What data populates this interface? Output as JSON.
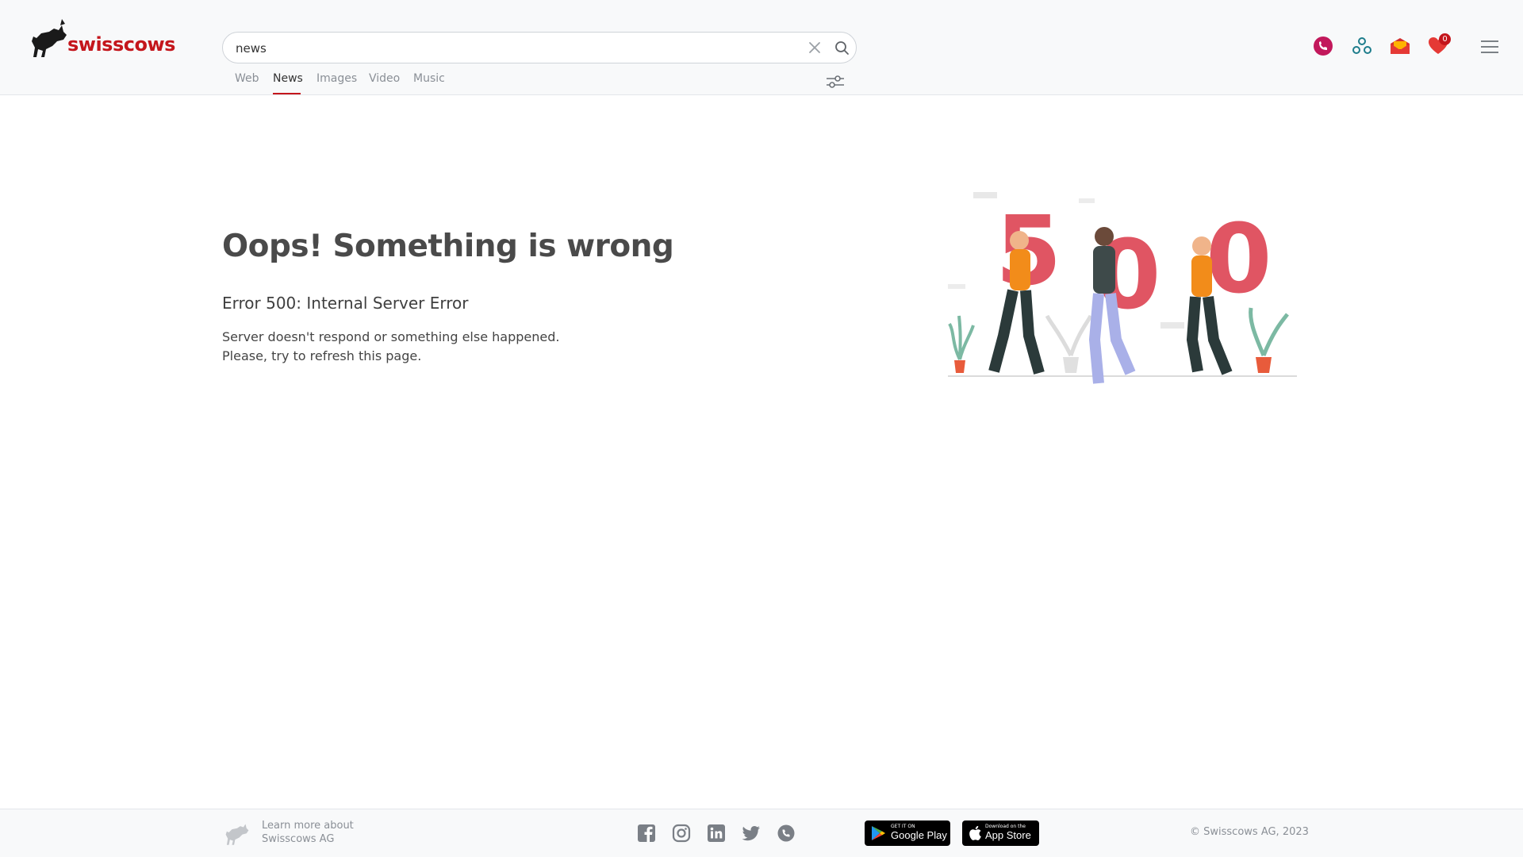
{
  "brand": {
    "name": "swisscows",
    "accent": "#c4161c"
  },
  "search": {
    "value": "news",
    "clear_icon": "close-icon",
    "search_icon": "search-icon"
  },
  "tabs": [
    {
      "label": "Web",
      "active": false
    },
    {
      "label": "News",
      "active": true
    },
    {
      "label": "Images",
      "active": false
    },
    {
      "label": "Video",
      "active": false
    },
    {
      "label": "Music",
      "active": false
    }
  ],
  "header_icons": [
    "teleguard-icon",
    "vpn-icon",
    "mail-icon",
    "heart-icon",
    "menu-icon"
  ],
  "favorites_count": "0",
  "error": {
    "title": "Oops! Something is wrong",
    "code": "Error 500: Internal Server Error",
    "line1": "Server doesn't respond or something else happened.",
    "line2": "Please, try to refresh this page."
  },
  "illustration": {
    "digits": [
      "5",
      "0",
      "0"
    ]
  },
  "footer": {
    "learn_line1": "Learn more about",
    "learn_line2": "Swisscows AG",
    "social": [
      "facebook-icon",
      "instagram-icon",
      "linkedin-icon",
      "twitter-icon",
      "teleguard-icon"
    ],
    "google_small": "GET IT ON",
    "google_big": "Google Play",
    "apple_small": "Download on the",
    "apple_big": "App Store",
    "copyright": "© Swisscows AG, 2023"
  }
}
